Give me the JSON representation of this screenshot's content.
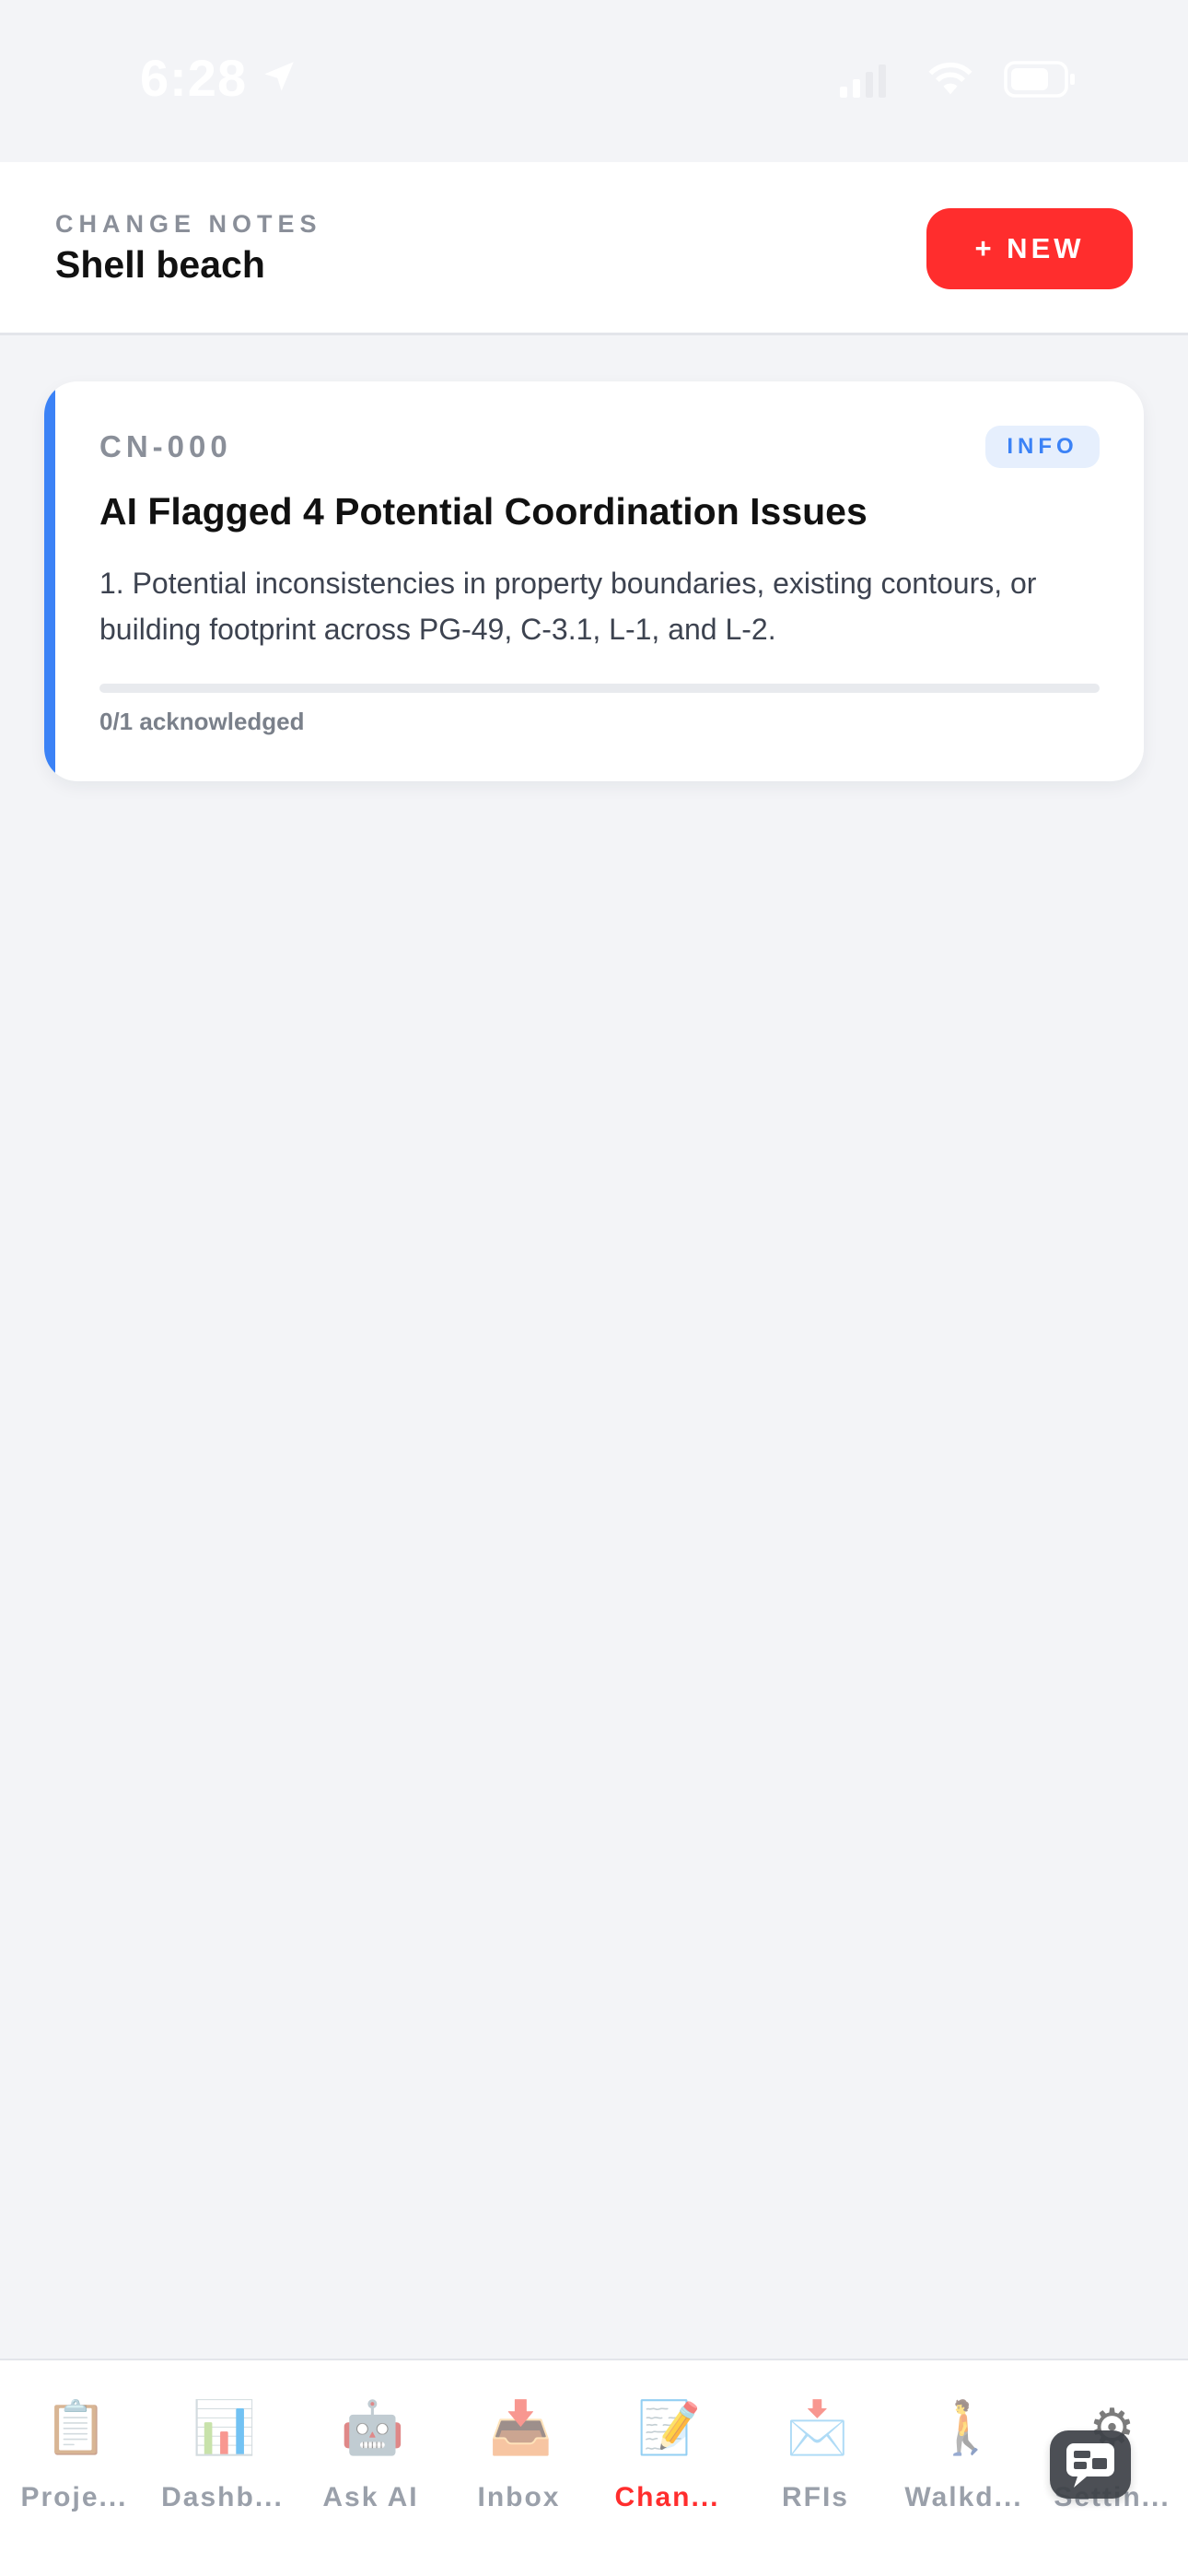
{
  "status_bar": {
    "time": "6:28",
    "icons": [
      "location-arrow-icon",
      "cellular-signal-icon",
      "wifi-icon",
      "battery-icon"
    ]
  },
  "header": {
    "eyebrow": "CHANGE NOTES",
    "title": "Shell beach",
    "new_button_label": "+ NEW"
  },
  "change_notes": [
    {
      "id": "CN-000",
      "badge": "INFO",
      "title": "AI Flagged 4 Potential Coordination Issues",
      "body": "1. Potential inconsistencies in property boundaries, existing contours, or building footprint across PG-49, C-3.1, L-1, and L-2.",
      "acknowledged_label": "0/1 acknowledged",
      "acknowledged_fraction": 0
    }
  ],
  "tab_bar": {
    "tabs": [
      {
        "label": "Proje...",
        "icon": "clipboard-icon"
      },
      {
        "label": "Dashb...",
        "icon": "bar-chart-icon"
      },
      {
        "label": "Ask AI",
        "icon": "robot-icon"
      },
      {
        "label": "Inbox",
        "icon": "inbox-tray-icon"
      },
      {
        "label": "Chan...",
        "icon": "memo-pencil-icon"
      },
      {
        "label": "RFIs",
        "icon": "incoming-envelope-icon"
      },
      {
        "label": "Walkd...",
        "icon": "walking-person-icon"
      },
      {
        "label": "Settin...",
        "icon": "gear-icon"
      }
    ],
    "active_tab": "Chan..."
  },
  "colors": {
    "accent_red": "#ff2d2d",
    "info_blue": "#3b82f6",
    "background": "#f3f4f7"
  }
}
